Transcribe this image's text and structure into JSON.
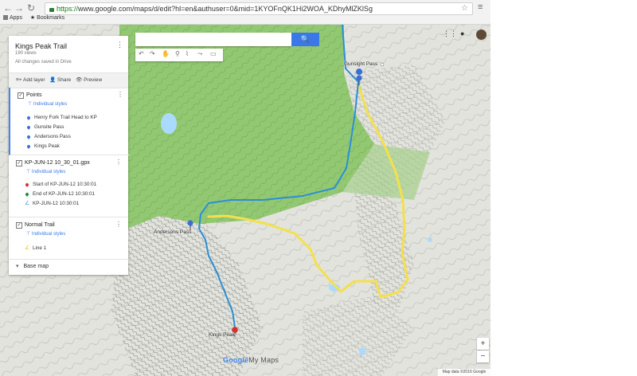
{
  "browser": {
    "url_scheme": "https://",
    "url_rest": "www.google.com/maps/d/edit?hl=en&authuser=0&mid=1KYOFnQK1Hi2WOA_KDhyMlZKlSg",
    "bookmarks": [
      "Apps",
      "Bookmarks"
    ]
  },
  "map_panel": {
    "title": "Kings Peak Trail",
    "views": "190 views",
    "saved_status": "All changes saved in Drive",
    "actions": {
      "add_layer": "Add layer",
      "share": "Share",
      "preview": "Preview"
    },
    "layers": [
      {
        "name": "Points",
        "style_link": "Individual styles",
        "items": [
          {
            "label": "Henry Fork Trail Head to KP",
            "color": "#3b6fd8"
          },
          {
            "label": "Gunsite Pass",
            "color": "#3b6fd8"
          },
          {
            "label": "Andersons Pass",
            "color": "#3b6fd8"
          },
          {
            "label": "Kings Peak",
            "color": "#3b6fd8"
          }
        ]
      },
      {
        "name": "KP-JUN-12 10_30_01.gpx",
        "style_link": "Individual styles",
        "items": [
          {
            "label": "Start of KP-JUN-12 10:30:01",
            "color": "#d32f2f"
          },
          {
            "label": "End of KP-JUN-12 10:30:01",
            "color": "#1e8e3e"
          },
          {
            "label": "KP-JUN-12 10:30:01",
            "color": "#4a90e2"
          }
        ]
      },
      {
        "name": "Normal Trail",
        "style_link": "Individual styles",
        "items": [
          {
            "label": "Line 1",
            "color": "#f2d600"
          }
        ]
      }
    ],
    "base_map": "Base map"
  },
  "map": {
    "labels": {
      "gunsight": "Gunsight Pass",
      "andersons": "Andersons Pass",
      "kings": "Kings Peak"
    },
    "attribution": "Map data ©2016 Google",
    "logo": {
      "google": "Google",
      "mymaps": "My Maps"
    },
    "zoom_in": "+",
    "zoom_out": "−",
    "colors": {
      "track_blue": "#2a8fd6",
      "trail_yellow": "#f4e04d",
      "forest_green": "#8cc26a"
    }
  }
}
